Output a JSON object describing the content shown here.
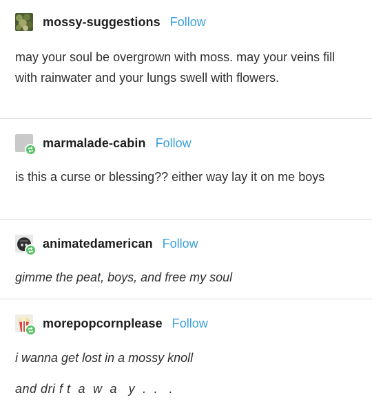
{
  "posts": [
    {
      "username": "mossy-suggestions",
      "follow_label": "Follow",
      "avatar_icon": "moss-avatar-icon",
      "text": "may your soul be overgrown with moss. may your veins fill with rainwater and your lungs swell with flowers."
    },
    {
      "username": "marmalade-cabin",
      "follow_label": "Follow",
      "avatar_icon": "blank-avatar-icon",
      "reblog_icon": "reblog-icon",
      "text": "is this a curse or blessing?? either way lay it on me boys"
    },
    {
      "username": "animatedamerican",
      "follow_label": "Follow",
      "avatar_icon": "hat-avatar-icon",
      "reblog_icon": "reblog-icon",
      "text": "gimme the peat, boys, and free my soul"
    },
    {
      "username": "morepopcornplease",
      "follow_label": "Follow",
      "avatar_icon": "popcorn-avatar-icon",
      "reblog_icon": "reblog-icon",
      "text_line1": "i wanna get lost in a mossy knoll",
      "text_line2": "and dri f t  a  w  a   y  .  .   ."
    }
  ],
  "colors": {
    "follow": "#3aa0d8",
    "reblog_badge": "#56c164",
    "divider": "#d6d6d6",
    "username": "#1e1e1e",
    "body_text": "#2e2e2e"
  }
}
